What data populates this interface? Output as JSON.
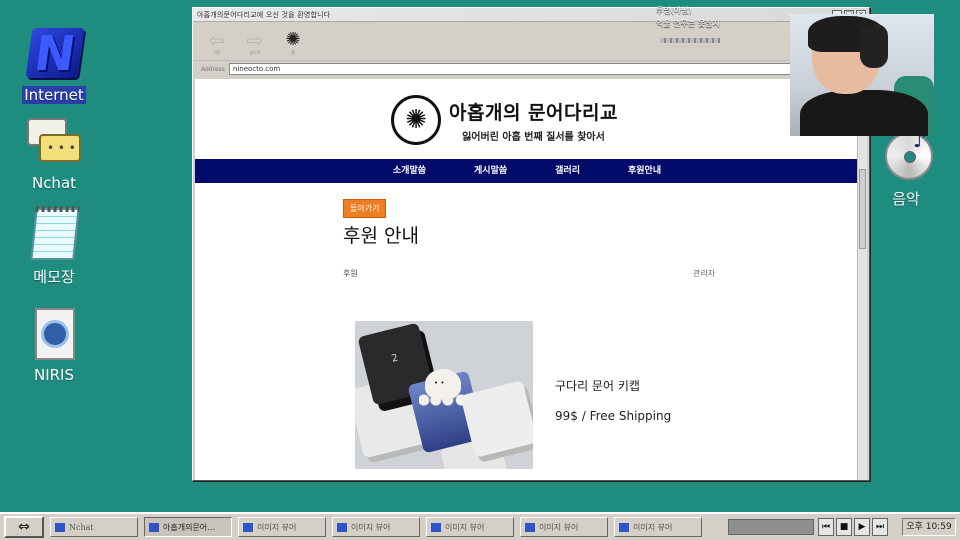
{
  "desktop": {
    "icons": [
      {
        "label": "Internet"
      },
      {
        "label": "Nchat"
      },
      {
        "label": "메모장"
      },
      {
        "label": "NIRIS"
      },
      {
        "label": "음악"
      }
    ]
  },
  "window": {
    "title": "아홉개의문어다리교에 오신 것을 환영합니다",
    "toolbar": {
      "back": "뒤로",
      "forward": "앞으로",
      "home": "홈"
    },
    "address_label": "Address",
    "url": "nineocto.com"
  },
  "site": {
    "title": "아홉개의 문어다리교",
    "subtitle": "잃어버린 아홉 번째 질서를 찾아서",
    "nav": [
      "소개말씀",
      "게시말씀",
      "갤러리",
      "후원안내"
    ]
  },
  "content": {
    "back_button": "돌아가기",
    "page_title": "후원 안내",
    "breadcrumb": "후원",
    "admin_link": "관리자",
    "product": {
      "name": "구다리 문어 키캡",
      "price": "99$ / Free Shipping"
    }
  },
  "overlay": {
    "line1": "투명(아님)",
    "line2": "억울 언무는 못참지"
  },
  "taskbar": {
    "tasks": [
      "Nchat",
      "아홉개의문어…",
      "이미지 뷰어",
      "이미지 뷰어",
      "이미지 뷰어",
      "이미지 뷰어",
      "이미지 뷰어"
    ],
    "clock": "오후 10:59"
  },
  "colors": {
    "desktop_bg": "#1f8c80",
    "nav_bg": "#020a6a",
    "back_button_bg": "#f07d22"
  },
  "icons": [
    "internet-icon",
    "chat-icon",
    "notepad-icon",
    "niris-icon",
    "music-cd-icon",
    "rocket-icon",
    "octopus-icon",
    "arrow-left-icon",
    "arrow-right-icon"
  ]
}
